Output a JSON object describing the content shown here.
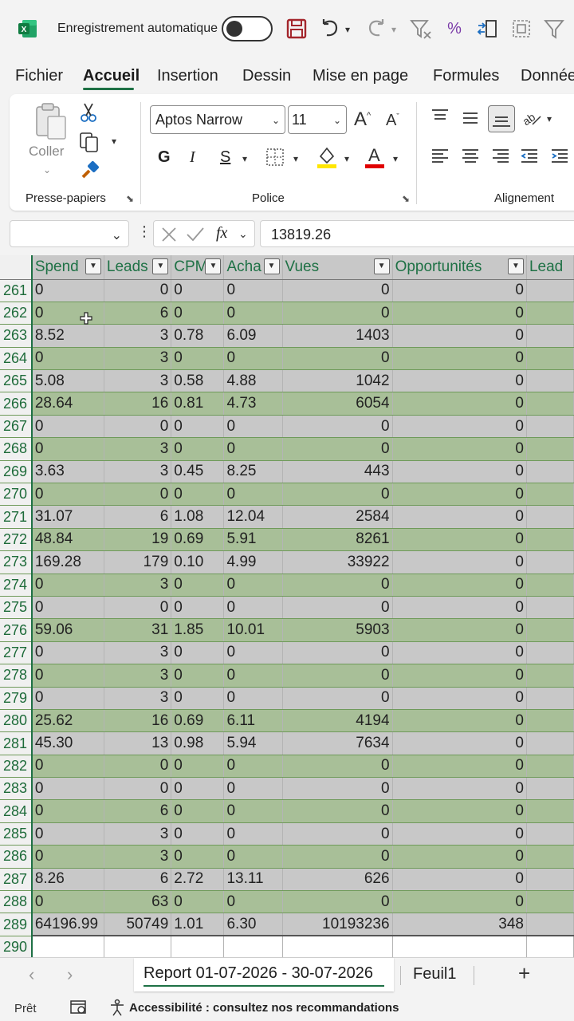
{
  "titlebar": {
    "autosave_label": "Enregistrement automatique",
    "autosave_state": "off"
  },
  "tabs": [
    "Fichier",
    "Accueil",
    "Insertion",
    "Dessin",
    "Mise en page",
    "Formules",
    "Donnée"
  ],
  "active_tab": "Accueil",
  "ribbon": {
    "paste_label": "Coller",
    "group_clipboard": "Presse-papiers",
    "group_font": "Police",
    "group_alignment": "Alignement",
    "font_name": "Aptos Narrow",
    "font_size": "11",
    "bold_label": "G",
    "italic_label": "I",
    "underline_label": "S",
    "font_color_label": "A"
  },
  "formula_bar": {
    "fx_label": "fx",
    "value": "13819.26"
  },
  "columns": [
    "Spend",
    "Leads",
    "CPM",
    "Acha",
    "Vues",
    "Opportunités",
    "Lead"
  ],
  "rows": [
    {
      "n": "261",
      "spend": "0",
      "leads": "0",
      "cpm": "0",
      "acha": "0",
      "vues": "0",
      "opp": "0"
    },
    {
      "n": "262",
      "spend": "0",
      "leads": "6",
      "cpm": "0",
      "acha": "0",
      "vues": "0",
      "opp": "0"
    },
    {
      "n": "263",
      "spend": "8.52",
      "leads": "3",
      "cpm": "0.78",
      "acha": "6.09",
      "vues": "1403",
      "opp": "0"
    },
    {
      "n": "264",
      "spend": "0",
      "leads": "3",
      "cpm": "0",
      "acha": "0",
      "vues": "0",
      "opp": "0"
    },
    {
      "n": "265",
      "spend": "5.08",
      "leads": "3",
      "cpm": "0.58",
      "acha": "4.88",
      "vues": "1042",
      "opp": "0"
    },
    {
      "n": "266",
      "spend": "28.64",
      "leads": "16",
      "cpm": "0.81",
      "acha": "4.73",
      "vues": "6054",
      "opp": "0"
    },
    {
      "n": "267",
      "spend": "0",
      "leads": "0",
      "cpm": "0",
      "acha": "0",
      "vues": "0",
      "opp": "0"
    },
    {
      "n": "268",
      "spend": "0",
      "leads": "3",
      "cpm": "0",
      "acha": "0",
      "vues": "0",
      "opp": "0"
    },
    {
      "n": "269",
      "spend": "3.63",
      "leads": "3",
      "cpm": "0.45",
      "acha": "8.25",
      "vues": "443",
      "opp": "0"
    },
    {
      "n": "270",
      "spend": "0",
      "leads": "0",
      "cpm": "0",
      "acha": "0",
      "vues": "0",
      "opp": "0"
    },
    {
      "n": "271",
      "spend": "31.07",
      "leads": "6",
      "cpm": "1.08",
      "acha": "12.04",
      "vues": "2584",
      "opp": "0"
    },
    {
      "n": "272",
      "spend": "48.84",
      "leads": "19",
      "cpm": "0.69",
      "acha": "5.91",
      "vues": "8261",
      "opp": "0"
    },
    {
      "n": "273",
      "spend": "169.28",
      "leads": "179",
      "cpm": "0.10",
      "acha": "4.99",
      "vues": "33922",
      "opp": "0"
    },
    {
      "n": "274",
      "spend": "0",
      "leads": "3",
      "cpm": "0",
      "acha": "0",
      "vues": "0",
      "opp": "0"
    },
    {
      "n": "275",
      "spend": "0",
      "leads": "0",
      "cpm": "0",
      "acha": "0",
      "vues": "0",
      "opp": "0"
    },
    {
      "n": "276",
      "spend": "59.06",
      "leads": "31",
      "cpm": "1.85",
      "acha": "10.01",
      "vues": "5903",
      "opp": "0"
    },
    {
      "n": "277",
      "spend": "0",
      "leads": "3",
      "cpm": "0",
      "acha": "0",
      "vues": "0",
      "opp": "0"
    },
    {
      "n": "278",
      "spend": "0",
      "leads": "3",
      "cpm": "0",
      "acha": "0",
      "vues": "0",
      "opp": "0"
    },
    {
      "n": "279",
      "spend": "0",
      "leads": "3",
      "cpm": "0",
      "acha": "0",
      "vues": "0",
      "opp": "0"
    },
    {
      "n": "280",
      "spend": "25.62",
      "leads": "16",
      "cpm": "0.69",
      "acha": "6.11",
      "vues": "4194",
      "opp": "0"
    },
    {
      "n": "281",
      "spend": "45.30",
      "leads": "13",
      "cpm": "0.98",
      "acha": "5.94",
      "vues": "7634",
      "opp": "0"
    },
    {
      "n": "282",
      "spend": "0",
      "leads": "0",
      "cpm": "0",
      "acha": "0",
      "vues": "0",
      "opp": "0"
    },
    {
      "n": "283",
      "spend": "0",
      "leads": "0",
      "cpm": "0",
      "acha": "0",
      "vues": "0",
      "opp": "0"
    },
    {
      "n": "284",
      "spend": "0",
      "leads": "6",
      "cpm": "0",
      "acha": "0",
      "vues": "0",
      "opp": "0"
    },
    {
      "n": "285",
      "spend": "0",
      "leads": "3",
      "cpm": "0",
      "acha": "0",
      "vues": "0",
      "opp": "0"
    },
    {
      "n": "286",
      "spend": "0",
      "leads": "3",
      "cpm": "0",
      "acha": "0",
      "vues": "0",
      "opp": "0"
    },
    {
      "n": "287",
      "spend": "8.26",
      "leads": "6",
      "cpm": "2.72",
      "acha": "13.11",
      "vues": "626",
      "opp": "0"
    },
    {
      "n": "288",
      "spend": "0",
      "leads": "63",
      "cpm": "0",
      "acha": "0",
      "vues": "0",
      "opp": "0"
    },
    {
      "n": "289",
      "spend": "64196.99",
      "leads": "50749",
      "cpm": "1.01",
      "acha": "6.30",
      "vues": "10193236",
      "opp": "348"
    }
  ],
  "empty_row": "290",
  "sheets": {
    "active": "Report 01-07-2026 - 30-07-2026",
    "other": "Feuil1",
    "add_label": "+"
  },
  "status": {
    "ready": "Prêt",
    "accessibility": "Accessibilité : consultez nos recommandations"
  },
  "colors": {
    "accent": "#1e7145",
    "band_gray": "#c8c8c8",
    "band_green": "#a8bf98"
  }
}
